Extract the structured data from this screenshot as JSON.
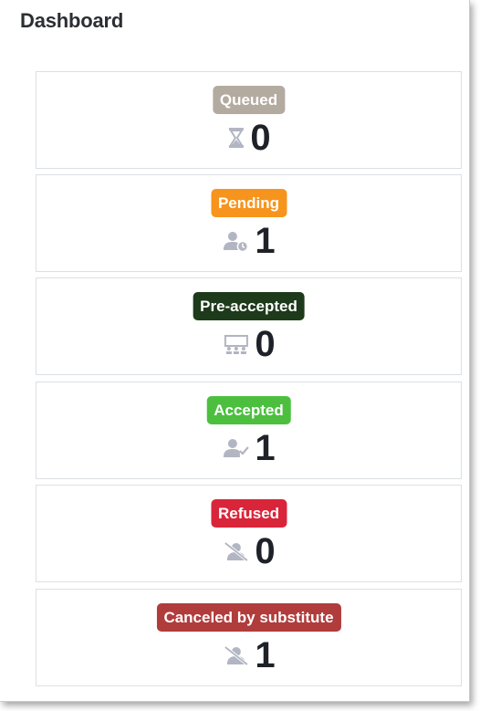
{
  "dashboard": {
    "title": "Dashboard",
    "cards": [
      {
        "label": "Queued",
        "count": "0",
        "color": "#b3aaa0",
        "icon": "hourglass-icon"
      },
      {
        "label": "Pending",
        "count": "1",
        "color": "#f7941d",
        "icon": "user-clock-icon"
      },
      {
        "label": "Pre-accepted",
        "count": "0",
        "color": "#1d3a1a",
        "icon": "group-board-icon"
      },
      {
        "label": "Accepted",
        "count": "1",
        "color": "#4cbf3f",
        "icon": "user-check-icon"
      },
      {
        "label": "Refused",
        "count": "0",
        "color": "#d9253a",
        "icon": "user-slash-icon"
      },
      {
        "label": "Canceled by substitute",
        "count": "1",
        "color": "#b13c3c",
        "icon": "user-slash-icon"
      }
    ],
    "icon_color": "#b2b5c2"
  }
}
